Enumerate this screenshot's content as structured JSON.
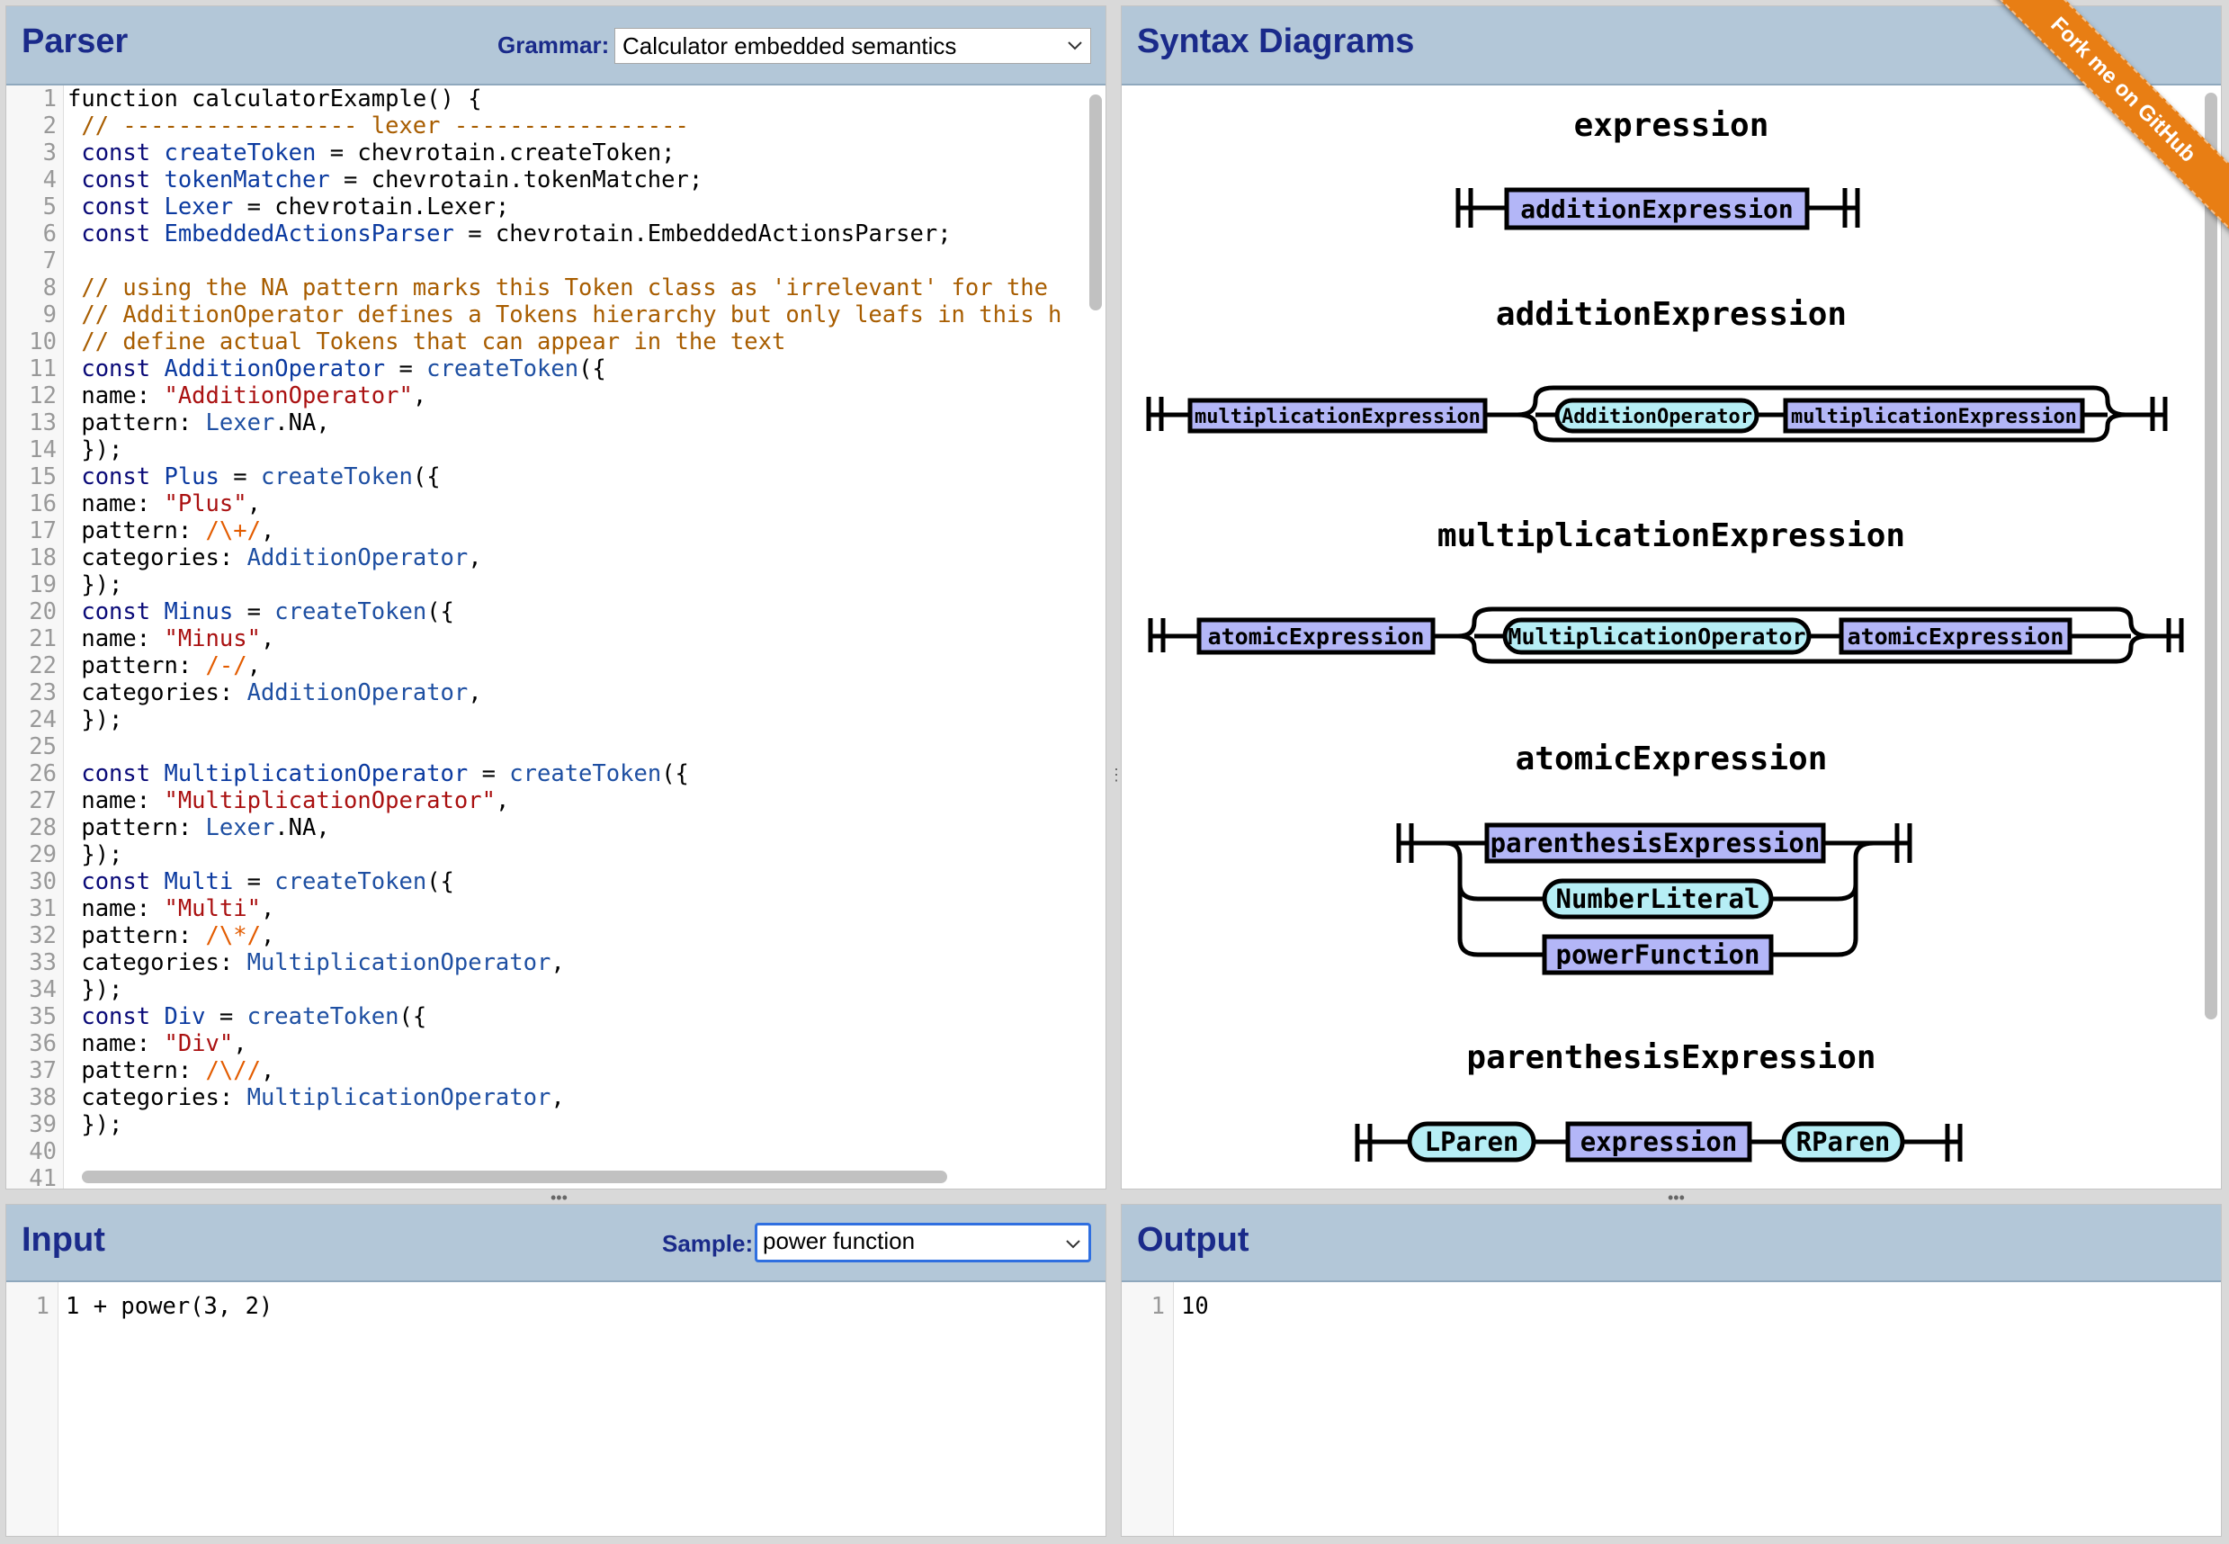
{
  "parser": {
    "title": "Parser",
    "grammar_label": "Grammar:",
    "grammar_selected": "Calculator embedded semantics"
  },
  "code_lines": [
    {
      "n": "1",
      "t": [
        [
          "p",
          "function"
        ],
        [
          "prop",
          " calculatorExample() {"
        ]
      ]
    },
    {
      "n": "2",
      "t": [
        [
          "com",
          " // ----------------- lexer -----------------"
        ]
      ]
    },
    {
      "n": "3",
      "t": [
        [
          "kw",
          " const "
        ],
        [
          "def",
          "createToken"
        ],
        [
          "prop",
          " = chevrotain.createToken;"
        ]
      ]
    },
    {
      "n": "4",
      "t": [
        [
          "kw",
          " const "
        ],
        [
          "def",
          "tokenMatcher"
        ],
        [
          "prop",
          " = chevrotain.tokenMatcher;"
        ]
      ]
    },
    {
      "n": "5",
      "t": [
        [
          "kw",
          " const "
        ],
        [
          "def",
          "Lexer"
        ],
        [
          "prop",
          " = chevrotain.Lexer;"
        ]
      ]
    },
    {
      "n": "6",
      "t": [
        [
          "kw",
          " const "
        ],
        [
          "def",
          "EmbeddedActionsParser"
        ],
        [
          "prop",
          " = chevrotain.EmbeddedActionsParser;"
        ]
      ]
    },
    {
      "n": "7",
      "t": []
    },
    {
      "n": "8",
      "t": [
        [
          "com",
          " // using the NA pattern marks this Token class as 'irrelevant' for the"
        ]
      ]
    },
    {
      "n": "9",
      "t": [
        [
          "com",
          " // AdditionOperator defines a Tokens hierarchy but only leafs in this h"
        ]
      ]
    },
    {
      "n": "10",
      "t": [
        [
          "com",
          " // define actual Tokens that can appear in the text"
        ]
      ]
    },
    {
      "n": "11",
      "t": [
        [
          "kw",
          " const "
        ],
        [
          "def",
          "AdditionOperator"
        ],
        [
          "prop",
          " = "
        ],
        [
          "var",
          "createToken"
        ],
        [
          "prop",
          "({"
        ]
      ]
    },
    {
      "n": "12",
      "t": [
        [
          "prop",
          " name: "
        ],
        [
          "str",
          "\"AdditionOperator\""
        ],
        [
          "prop",
          ","
        ]
      ]
    },
    {
      "n": "13",
      "t": [
        [
          "prop",
          " pattern: "
        ],
        [
          "var",
          "Lexer"
        ],
        [
          "prop",
          ".NA,"
        ]
      ]
    },
    {
      "n": "14",
      "t": [
        [
          "prop",
          " });"
        ]
      ]
    },
    {
      "n": "15",
      "t": [
        [
          "kw",
          " const "
        ],
        [
          "def",
          "Plus"
        ],
        [
          "prop",
          " = "
        ],
        [
          "var",
          "createToken"
        ],
        [
          "prop",
          "({"
        ]
      ]
    },
    {
      "n": "16",
      "t": [
        [
          "prop",
          " name: "
        ],
        [
          "str",
          "\"Plus\""
        ],
        [
          "prop",
          ","
        ]
      ]
    },
    {
      "n": "17",
      "t": [
        [
          "prop",
          " pattern: "
        ],
        [
          "re",
          "/\\+/"
        ],
        [
          "prop",
          ","
        ]
      ]
    },
    {
      "n": "18",
      "t": [
        [
          "prop",
          " categories: "
        ],
        [
          "var",
          "AdditionOperator"
        ],
        [
          "prop",
          ","
        ]
      ]
    },
    {
      "n": "19",
      "t": [
        [
          "prop",
          " });"
        ]
      ]
    },
    {
      "n": "20",
      "t": [
        [
          "kw",
          " const "
        ],
        [
          "def",
          "Minus"
        ],
        [
          "prop",
          " = "
        ],
        [
          "var",
          "createToken"
        ],
        [
          "prop",
          "({"
        ]
      ]
    },
    {
      "n": "21",
      "t": [
        [
          "prop",
          " name: "
        ],
        [
          "str",
          "\"Minus\""
        ],
        [
          "prop",
          ","
        ]
      ]
    },
    {
      "n": "22",
      "t": [
        [
          "prop",
          " pattern: "
        ],
        [
          "re",
          "/-/"
        ],
        [
          "prop",
          ","
        ]
      ]
    },
    {
      "n": "23",
      "t": [
        [
          "prop",
          " categories: "
        ],
        [
          "var",
          "AdditionOperator"
        ],
        [
          "prop",
          ","
        ]
      ]
    },
    {
      "n": "24",
      "t": [
        [
          "prop",
          " });"
        ]
      ]
    },
    {
      "n": "25",
      "t": []
    },
    {
      "n": "26",
      "t": [
        [
          "kw",
          " const "
        ],
        [
          "def",
          "MultiplicationOperator"
        ],
        [
          "prop",
          " = "
        ],
        [
          "var",
          "createToken"
        ],
        [
          "prop",
          "({"
        ]
      ]
    },
    {
      "n": "27",
      "t": [
        [
          "prop",
          " name: "
        ],
        [
          "str",
          "\"MultiplicationOperator\""
        ],
        [
          "prop",
          ","
        ]
      ]
    },
    {
      "n": "28",
      "t": [
        [
          "prop",
          " pattern: "
        ],
        [
          "var",
          "Lexer"
        ],
        [
          "prop",
          ".NA,"
        ]
      ]
    },
    {
      "n": "29",
      "t": [
        [
          "prop",
          " });"
        ]
      ]
    },
    {
      "n": "30",
      "t": [
        [
          "kw",
          " const "
        ],
        [
          "def",
          "Multi"
        ],
        [
          "prop",
          " = "
        ],
        [
          "var",
          "createToken"
        ],
        [
          "prop",
          "({"
        ]
      ]
    },
    {
      "n": "31",
      "t": [
        [
          "prop",
          " name: "
        ],
        [
          "str",
          "\"Multi\""
        ],
        [
          "prop",
          ","
        ]
      ]
    },
    {
      "n": "32",
      "t": [
        [
          "prop",
          " pattern: "
        ],
        [
          "re",
          "/\\*/"
        ],
        [
          "prop",
          ","
        ]
      ]
    },
    {
      "n": "33",
      "t": [
        [
          "prop",
          " categories: "
        ],
        [
          "var",
          "MultiplicationOperator"
        ],
        [
          "prop",
          ","
        ]
      ]
    },
    {
      "n": "34",
      "t": [
        [
          "prop",
          " });"
        ]
      ]
    },
    {
      "n": "35",
      "t": [
        [
          "kw",
          " const "
        ],
        [
          "def",
          "Div"
        ],
        [
          "prop",
          " = "
        ],
        [
          "var",
          "createToken"
        ],
        [
          "prop",
          "({"
        ]
      ]
    },
    {
      "n": "36",
      "t": [
        [
          "prop",
          " name: "
        ],
        [
          "str",
          "\"Div\""
        ],
        [
          "prop",
          ","
        ]
      ]
    },
    {
      "n": "37",
      "t": [
        [
          "prop",
          " pattern: "
        ],
        [
          "re",
          "/\\//"
        ],
        [
          "prop",
          ","
        ]
      ]
    },
    {
      "n": "38",
      "t": [
        [
          "prop",
          " categories: "
        ],
        [
          "var",
          "MultiplicationOperator"
        ],
        [
          "prop",
          ","
        ]
      ]
    },
    {
      "n": "39",
      "t": [
        [
          "prop",
          " });"
        ]
      ]
    },
    {
      "n": "40",
      "t": []
    },
    {
      "n": "41",
      "t": []
    }
  ],
  "diagrams": {
    "title": "Syntax Diagrams",
    "ribbon": "Fork me on GitHub",
    "rules": {
      "expression": {
        "title": "expression",
        "items": [
          "additionExpression"
        ]
      },
      "addition": {
        "title": "additionExpression",
        "items": [
          "multiplicationExpression",
          "AdditionOperator",
          "multiplicationExpression"
        ]
      },
      "multiplication": {
        "title": "multiplicationExpression",
        "items": [
          "atomicExpression",
          "MultiplicationOperator",
          "atomicExpression"
        ]
      },
      "atomic": {
        "title": "atomicExpression",
        "items": [
          "parenthesisExpression",
          "NumberLiteral",
          "powerFunction"
        ]
      },
      "parenthesis": {
        "title": "parenthesisExpression",
        "items": [
          "LParen",
          "expression",
          "RParen"
        ]
      }
    },
    "colors": {
      "nonterminal": "#b3b6f7",
      "terminal": "#b6eef5"
    }
  },
  "input": {
    "title": "Input",
    "sample_label": "Sample:",
    "sample_selected": "power function",
    "lines": [
      {
        "n": "1",
        "text": "1 + power(3, 2)"
      }
    ]
  },
  "output": {
    "title": "Output",
    "lines": [
      {
        "n": "1",
        "text": "10"
      }
    ]
  }
}
